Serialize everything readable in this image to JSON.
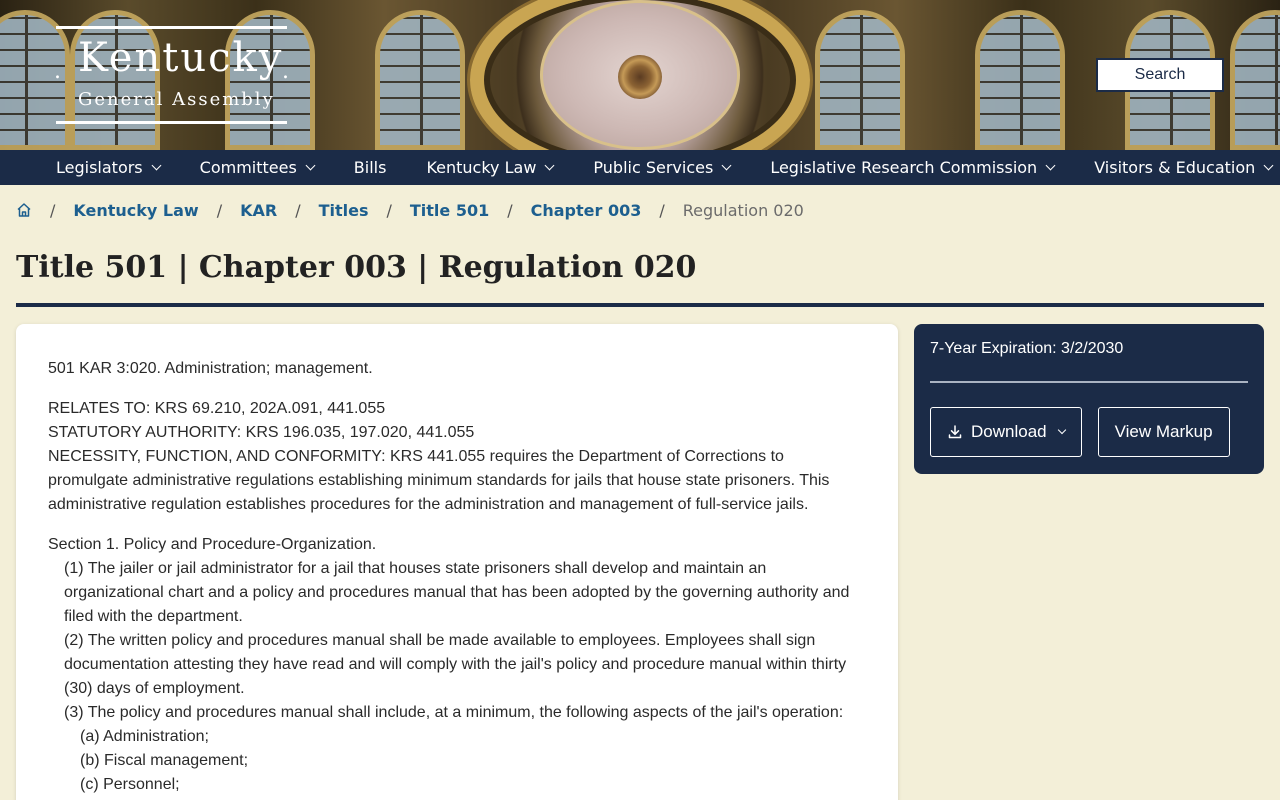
{
  "header": {
    "brand_name": "Kentucky",
    "brand_sub": "General Assembly",
    "search_label": "Search"
  },
  "nav": {
    "items": [
      {
        "label": "Legislators",
        "dropdown": true
      },
      {
        "label": "Committees",
        "dropdown": true
      },
      {
        "label": "Bills",
        "dropdown": false
      },
      {
        "label": "Kentucky Law",
        "dropdown": true
      },
      {
        "label": "Public Services",
        "dropdown": true
      },
      {
        "label": "Legislative Research Commission",
        "dropdown": true
      },
      {
        "label": "Visitors & Education",
        "dropdown": true
      }
    ]
  },
  "breadcrumb": {
    "items": [
      "Kentucky Law",
      "KAR",
      "Titles",
      "Title 501",
      "Chapter 003"
    ],
    "current": "Regulation 020"
  },
  "page_title": "Title 501 | Chapter 003 | Regulation 020",
  "regulation": {
    "heading": "501 KAR 3:020.  Administration; management.",
    "relates_to": "RELATES TO:  KRS 69.210, 202A.091, 441.055",
    "authority": "STATUTORY AUTHORITY:  KRS 196.035, 197.020, 441.055",
    "necessity": "NECESSITY, FUNCTION, AND CONFORMITY:  KRS 441.055 requires the Department of Corrections to promulgate administrative regulations establishing minimum standards for jails that house state prisoners. This administrative regulation establishes procedures for the administration and management of full-service jails.",
    "section1_title": "Section 1.  Policy and Procedure-Organization.",
    "s1_p1": "(1)  The jailer or jail administrator for a jail that houses state prisoners shall develop and maintain an organizational chart and a policy and procedures manual that has been adopted by the governing authority and filed with the department.",
    "s1_p2": "(2)  The written policy and procedures manual shall be made available to employees. Employees shall sign documentation attesting they have read and will comply with the jail's policy and procedure manual within thirty (30) days of employment.",
    "s1_p3": "(3)  The policy and procedures manual shall include, at a minimum, the following aspects of the jail's operation:",
    "s1_p3_a": "(a)  Administration;",
    "s1_p3_b": "(b)  Fiscal management;",
    "s1_p3_c": "(c)  Personnel;"
  },
  "sidebar": {
    "expiration": "7-Year Expiration: 3/2/2030",
    "download_label": "Download",
    "view_markup_label": "View Markup"
  },
  "colors": {
    "navy": "#1b2b47",
    "link": "#1d5f8f",
    "page_bg": "#f3efd8"
  }
}
